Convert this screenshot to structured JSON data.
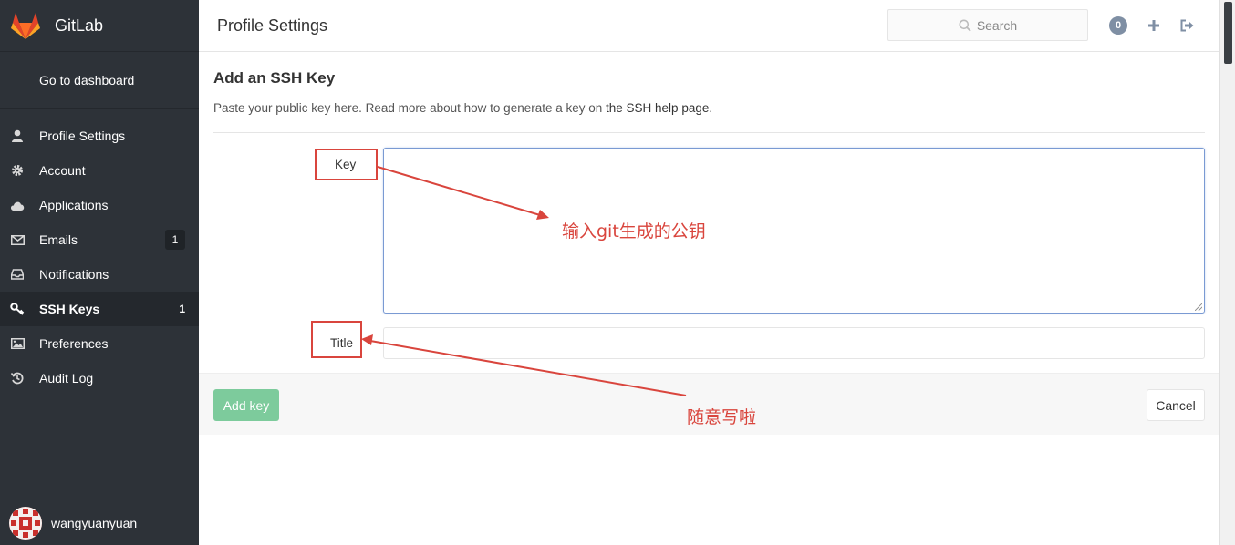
{
  "brand": {
    "name": "GitLab"
  },
  "sidebar": {
    "dashboard_label": "Go to dashboard",
    "items": [
      {
        "label": "Profile Settings",
        "icon": "user-icon",
        "count": ""
      },
      {
        "label": "Account",
        "icon": "gear-icon",
        "count": ""
      },
      {
        "label": "Applications",
        "icon": "cloud-icon",
        "count": ""
      },
      {
        "label": "Emails",
        "icon": "envelope-icon",
        "count": "1"
      },
      {
        "label": "Notifications",
        "icon": "inbox-icon",
        "count": ""
      },
      {
        "label": "SSH Keys",
        "icon": "key-icon",
        "count": "1"
      },
      {
        "label": "Preferences",
        "icon": "image-icon",
        "count": ""
      },
      {
        "label": "Audit Log",
        "icon": "history-icon",
        "count": ""
      }
    ],
    "active_item": "SSH Keys",
    "user": "wangyuanyuan"
  },
  "header": {
    "title": "Profile Settings",
    "search_placeholder": "Search",
    "notification_count": "0"
  },
  "form": {
    "heading": "Add an SSH Key",
    "description": "Paste your public key here. Read more about how to generate a key on ",
    "help_link": "the SSH help page.",
    "key_label": "Key",
    "key_value": "",
    "title_label": "Title",
    "title_value": "",
    "add_button": "Add key",
    "cancel_button": "Cancel"
  },
  "annotations": {
    "key_note": "输入git生成的公钥",
    "title_note": "随意写啦",
    "color": "#d9453d"
  },
  "colors": {
    "sidebar_bg": "#2d3238",
    "add_button": "#7dcb9c"
  }
}
